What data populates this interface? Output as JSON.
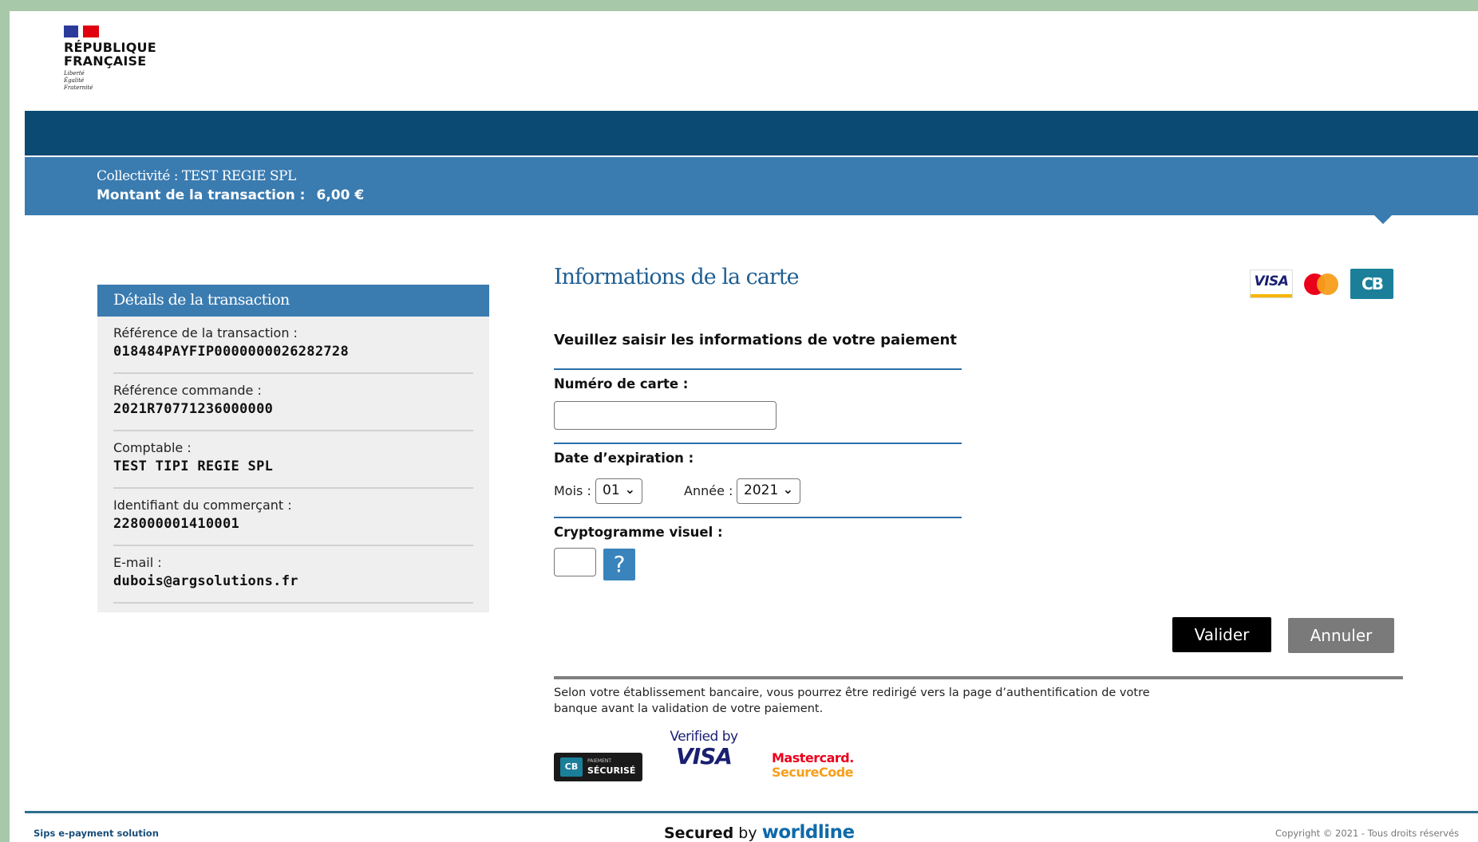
{
  "logo": {
    "line1": "RÉPUBLIQUE",
    "line2": "FRANÇAISE",
    "motto": [
      "Liberté",
      "Égalité",
      "Fraternité"
    ],
    "colors": {
      "blue": "#2b3b9a",
      "red": "#e1000f"
    }
  },
  "header": {
    "collectivite": "Collectivité : TEST REGIE SPL",
    "montant_label": "Montant de la transaction :",
    "montant_value": "6,00 €"
  },
  "details": {
    "title": "Détails de la transaction",
    "rows": [
      {
        "label": "Référence de la transaction :",
        "value": "018484PAYFIP0000000026282728"
      },
      {
        "label": "Référence commande :",
        "value": "2021R70771236000000"
      },
      {
        "label": "Comptable :",
        "value": "TEST TIPI REGIE SPL"
      },
      {
        "label": "Identifiant du commerçant :",
        "value": "228000001410001"
      },
      {
        "label": "E-mail :",
        "value": "dubois@argsolutions.fr"
      }
    ]
  },
  "form": {
    "title": "Informations de la carte",
    "subtitle": "Veuillez saisir les informations de votre paiement",
    "card_number_label": "Numéro de carte :",
    "card_number_value": "",
    "expiry_label": "Date d’expiration :",
    "month_label": "Mois :",
    "month_value": "01",
    "year_label": "Année :",
    "year_value": "2021",
    "cvv_label": "Cryptogramme visuel :",
    "cvv_help": "?",
    "accepted_cards": [
      "visa-icon",
      "mastercard-icon",
      "cb-icon"
    ],
    "card_logo_text": {
      "visa": "VISA",
      "cb": "CB"
    }
  },
  "buttons": {
    "valider": "Valider",
    "annuler": "Annuler"
  },
  "notice": "Selon votre établissement bancaire, vous pourrez être redirigé vers la page d’authentification de votre banque avant la validation de votre paiement.",
  "secure_logos": {
    "cb_small": "PAIEMENT",
    "cb_big": "SÉCURISÉ",
    "cb_mark": "CB",
    "vbv_line1": "Verified by",
    "vbv_line2": "VISA",
    "msc_line1": "Mastercard.",
    "msc_line2": "SecureCode"
  },
  "footer": {
    "left": "Sips e-payment solution",
    "secured": "Secured",
    "by": "by",
    "brand": "worldline",
    "right": "Copyright © 2021 - Tous droits réservés"
  },
  "colors": {
    "dark_band": "#0b4a72",
    "light_band": "#3a7bb0",
    "title_blue": "#1f5f93",
    "frame_green": "#a8c8aa"
  }
}
